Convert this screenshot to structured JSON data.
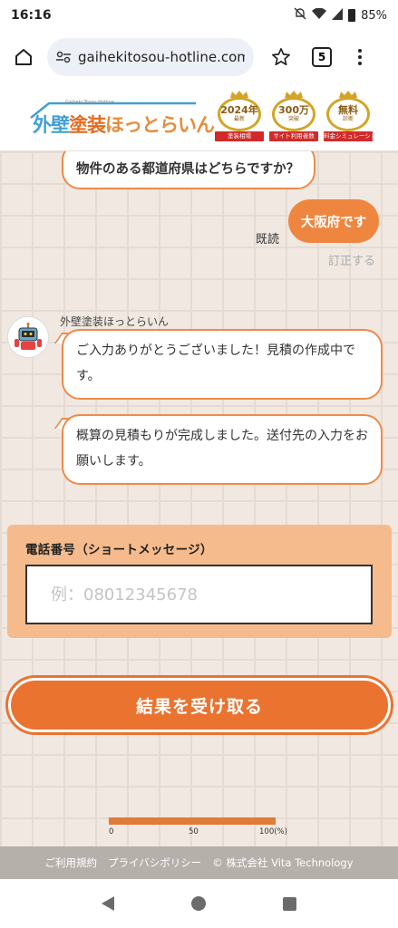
{
  "status_bar": {
    "time": "16:16",
    "battery": "85%"
  },
  "browser": {
    "url": "gaihekitosou-hotline.com",
    "tab_count": "5"
  },
  "site": {
    "logo_sub": "Gaiheki Tosou Hotline",
    "logo_parts": [
      "外壁",
      "塗装",
      "ほっとらいん"
    ],
    "badges": [
      {
        "main": "2024年",
        "small": "最新",
        "ribbon": "塗装相場"
      },
      {
        "main": "300万",
        "small": "突破",
        "ribbon": "サイト利用者数"
      },
      {
        "main": "無料",
        "small": "診断",
        "ribbon": "料金シミュレーション"
      }
    ]
  },
  "chat": {
    "question": "物件のある都道府県はどちらですか？",
    "user_answer": "大阪府です",
    "read_receipt": "既読",
    "correct_link": "訂正する",
    "sender_name": "外壁塗装ほっとらいん",
    "message1": "ご入力ありがとうございました！見積の作成中です。",
    "message2": "概算の見積もりが完成しました。送付先の入力をお願いします。"
  },
  "form": {
    "phone_label": "電話番号（ショートメッセージ）",
    "phone_placeholder": "例：08012345678",
    "phone_value": "",
    "submit_label": "結果を受け取る"
  },
  "progress": {
    "value": 100,
    "labels": [
      "0",
      "50",
      "100(%)"
    ]
  },
  "footer": {
    "terms": "ご利用規約",
    "privacy": "プライバシポリシー",
    "copyright": "© 株式会社 Vita Technology"
  },
  "colors": {
    "accent": "#ea7330",
    "card": "#f6bb8c",
    "brand_blue": "#3f9fd6"
  }
}
